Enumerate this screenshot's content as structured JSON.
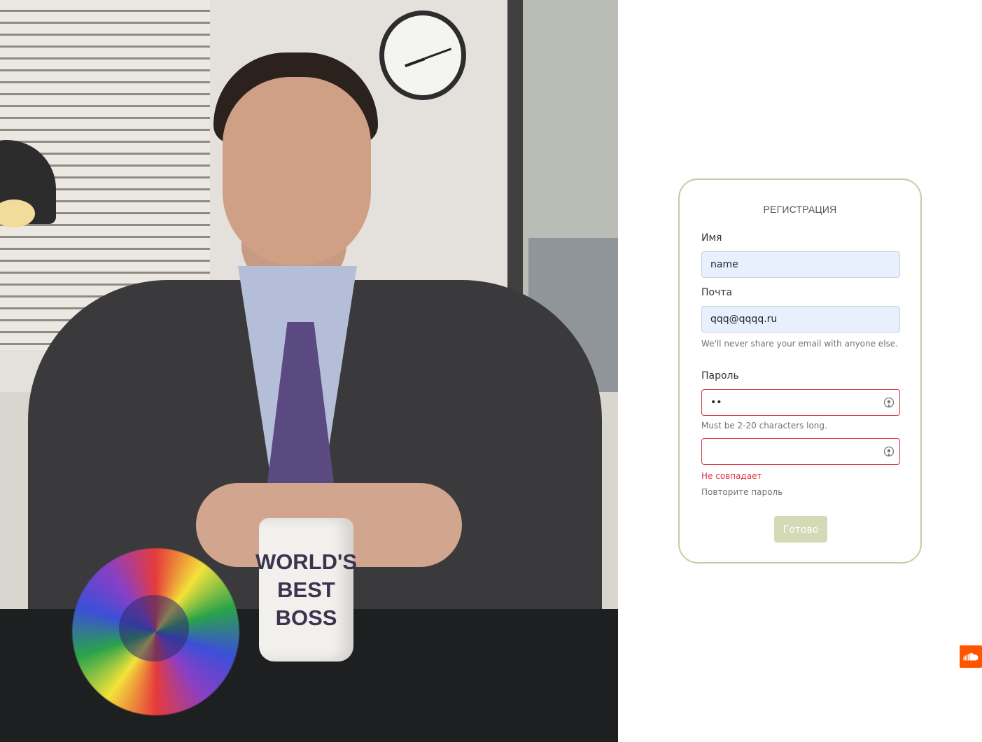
{
  "photo": {
    "mug_text": "WORLD'S\nBEST\nBOSS"
  },
  "form": {
    "title": "РЕГИСТРАЦИЯ",
    "name": {
      "label": "Имя",
      "value": "name"
    },
    "email": {
      "label": "Почта",
      "value": "qqq@qqqq.ru",
      "help": "We'll never share your email with anyone else."
    },
    "password": {
      "label": "Пароль",
      "value": "••",
      "help": "Must be 2-20 characters long."
    },
    "confirm": {
      "value": "",
      "error": "Не совпадает",
      "help": "Повторите пароль"
    },
    "submit_label": "Готово"
  },
  "colors": {
    "card_border": "#c6cc9e",
    "button_bg": "#d4d9b6",
    "error": "#dc3545",
    "autofill_bg": "#e8f0fe",
    "soundcloud": "#ff5500"
  },
  "icons": {
    "password_toggle": "eye-icon",
    "floating_widget": "soundcloud-icon"
  }
}
